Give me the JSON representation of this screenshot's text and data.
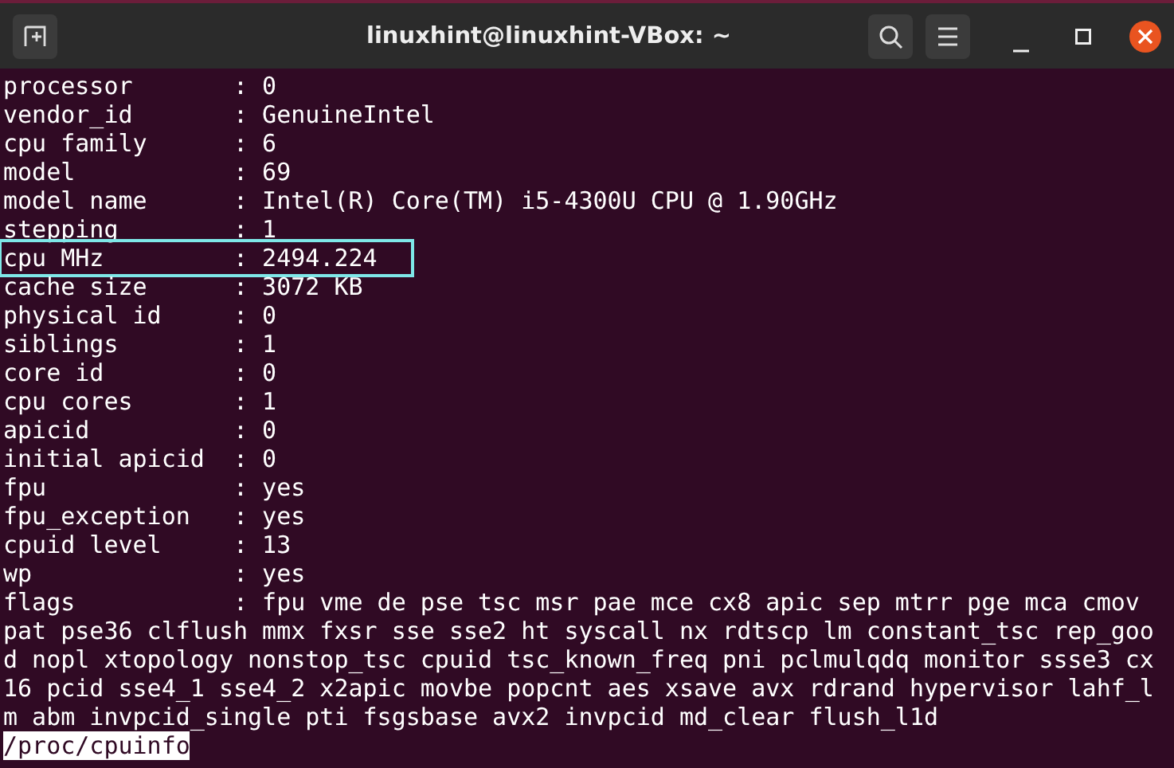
{
  "window": {
    "title": "linuxhint@linuxhint-VBox: ~"
  },
  "lines": [
    {
      "text": "processor       : 0",
      "highlighted": false
    },
    {
      "text": "vendor_id       : GenuineIntel",
      "highlighted": false
    },
    {
      "text": "cpu family      : 6",
      "highlighted": false
    },
    {
      "text": "model           : 69",
      "highlighted": false
    },
    {
      "text": "model name      : Intel(R) Core(TM) i5-4300U CPU @ 1.90GHz",
      "highlighted": false
    },
    {
      "text": "stepping        : 1",
      "highlighted": false
    },
    {
      "text": "cpu MHz         : 2494.224",
      "highlighted": true
    },
    {
      "text": "cache size      : 3072 KB",
      "highlighted": false
    },
    {
      "text": "physical id     : 0",
      "highlighted": false
    },
    {
      "text": "siblings        : 1",
      "highlighted": false
    },
    {
      "text": "core id         : 0",
      "highlighted": false
    },
    {
      "text": "cpu cores       : 1",
      "highlighted": false
    },
    {
      "text": "apicid          : 0",
      "highlighted": false
    },
    {
      "text": "initial apicid  : 0",
      "highlighted": false
    },
    {
      "text": "fpu             : yes",
      "highlighted": false
    },
    {
      "text": "fpu_exception   : yes",
      "highlighted": false
    },
    {
      "text": "cpuid level     : 13",
      "highlighted": false
    },
    {
      "text": "wp              : yes",
      "highlighted": false
    },
    {
      "text": "flags           : fpu vme de pse tsc msr pae mce cx8 apic sep mtrr pge mca cmov",
      "highlighted": false
    },
    {
      "text": "pat pse36 clflush mmx fxsr sse sse2 ht syscall nx rdtscp lm constant_tsc rep_goo",
      "highlighted": false
    },
    {
      "text": "d nopl xtopology nonstop_tsc cpuid tsc_known_freq pni pclmulqdq monitor ssse3 cx",
      "highlighted": false
    },
    {
      "text": "16 pcid sse4_1 sse4_2 x2apic movbe popcnt aes xsave avx rdrand hypervisor lahf_l",
      "highlighted": false
    },
    {
      "text": "m abm invpcid_single pti fsgsbase avx2 invpcid md_clear flush_l1d",
      "highlighted": false
    }
  ],
  "prompt": "/proc/cpuinfo"
}
